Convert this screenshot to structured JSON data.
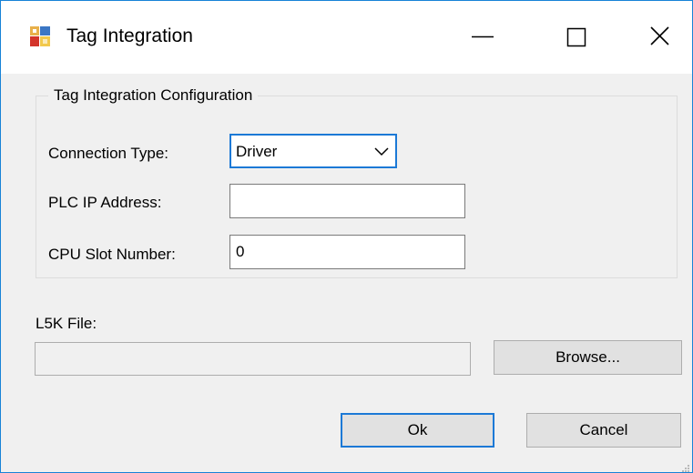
{
  "window": {
    "title": "Tag Integration",
    "icon": "tag-integration-app-icon",
    "controls": {
      "minimize": "minimize-icon",
      "maximize": "maximize-icon",
      "close": "close-icon"
    }
  },
  "group": {
    "legend": "Tag Integration Configuration",
    "connection_type_label": "Connection Type:",
    "connection_type_value": "Driver",
    "plc_ip_label": "PLC IP Address:",
    "plc_ip_value": "",
    "cpu_slot_label": "CPU Slot Number:",
    "cpu_slot_value": "0"
  },
  "file": {
    "label": "L5K File:",
    "value": "",
    "browse_label": "Browse..."
  },
  "buttons": {
    "ok_label": "Ok",
    "cancel_label": "Cancel"
  },
  "colors": {
    "accent": "#1c79d6",
    "window_border": "#1883d7",
    "dialog_bg": "#f0f0f0"
  }
}
